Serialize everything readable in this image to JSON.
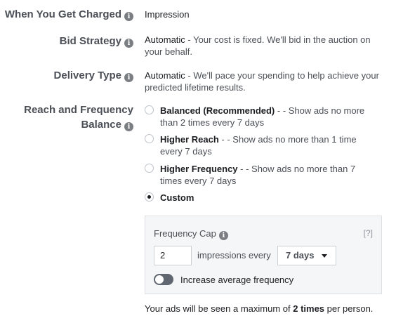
{
  "rows": {
    "charged": {
      "label": "When You Get Charged",
      "value": "Impression"
    },
    "bid": {
      "label": "Bid Strategy",
      "value_lead": "Automatic",
      "value_rest": " - Your cost is fixed. We'll bid in the auction on your behalf."
    },
    "delivery": {
      "label": "Delivery Type",
      "value_lead": "Automatic",
      "value_rest": " - We'll pace your spending to help achieve your predicted lifetime results."
    },
    "reach": {
      "label_line1": "Reach and Frequency",
      "label_line2": "Balance"
    }
  },
  "options": [
    {
      "title": "Balanced (Recommended)",
      "desc": " - - Show ads no more than 2 times every 7 days",
      "selected": false
    },
    {
      "title": "Higher Reach",
      "desc": " - - Show ads no more than 1 time every 7 days",
      "selected": false
    },
    {
      "title": "Higher Frequency",
      "desc": " - - Show ads no more than 7 times every 7 days",
      "selected": false
    },
    {
      "title": "Custom",
      "desc": "",
      "selected": true
    }
  ],
  "frequency_cap": {
    "title": "Frequency Cap",
    "help": "[?]",
    "impressions_value": "2",
    "impressions_label": "impressions every",
    "period": "7 days",
    "toggle_label": "Increase average frequency",
    "toggle_on": false
  },
  "summary": {
    "prefix": "Your ads will be seen a maximum of ",
    "bold": "2 times",
    "suffix": " per person."
  },
  "icons": {
    "info": "info-icon",
    "caret": "caret-down-icon"
  }
}
